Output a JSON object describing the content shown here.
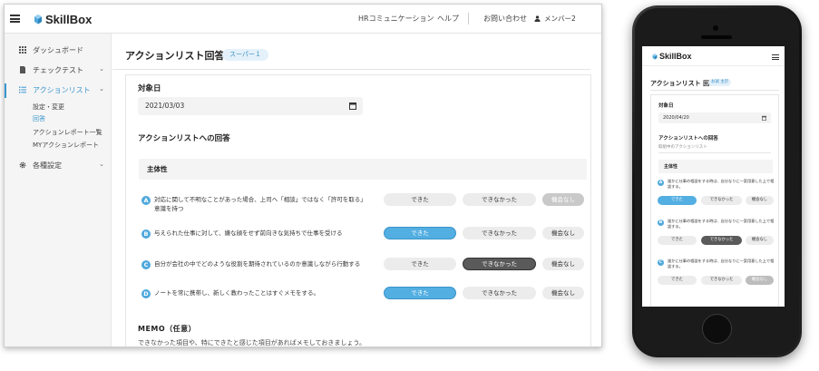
{
  "desktop": {
    "logo": "SkillBox",
    "nav": {
      "hr_communication": "HRコミュニケーション",
      "help": "ヘルプ",
      "contact": "お問い合わせ",
      "user": "メンバー2"
    },
    "sidebar": {
      "items": [
        {
          "label": "ダッシュボード",
          "icon": "grid-icon"
        },
        {
          "label": "チェックテスト",
          "icon": "document-icon"
        },
        {
          "label": "アクションリスト",
          "icon": "list-icon"
        },
        {
          "label": "各種設定",
          "icon": "gear-icon"
        }
      ],
      "sub_items": [
        "設定・変更",
        "回答",
        "アクションレポート一覧",
        "MYアクションレポート"
      ]
    },
    "page_title": "アクションリスト回答",
    "badge": "スーパー１",
    "date_label": "対象日",
    "date_value": "2021/03/03",
    "answers_heading": "アクションリストへの回答",
    "category": "主体性",
    "options": [
      "できた",
      "できなかった",
      "機会なし"
    ],
    "questions": [
      {
        "letter": "A",
        "text": "対応に関して不明なことがあった場合、上司へ「相談」ではなく「許可を取る」意識を持つ",
        "selected": 2
      },
      {
        "letter": "B",
        "text": "与えられた仕事に対して、嫌な顔をせず前向きな気持ちで仕事を受ける",
        "selected": 0
      },
      {
        "letter": "C",
        "text": "自分が会社の中でどのような役割を期待されているのか意識しながら行動する",
        "selected": 1
      },
      {
        "letter": "D",
        "text": "ノートを常に携帯し、新しく教わったことはすぐメモをする。",
        "selected": 0
      }
    ],
    "memo_title": "MEMO（任意）",
    "memo_desc": "できなかった項目や、特にできたと感じた項目があればメモしておきましょう。"
  },
  "mobile": {
    "logo": "SkillBox",
    "page_title": "アクションリスト 回答",
    "badge": "お試 主於",
    "date_label": "対象日",
    "date_value": "2020/04/20",
    "answers_heading": "アクションリストへの回答",
    "help": "取組中のアクションリスト",
    "category": "主体性",
    "options": [
      "できた",
      "できなかった",
      "機会なし"
    ],
    "questions": [
      {
        "letter": "A",
        "text": "誰かに仕事の相談をする時は、自分なりに一案用意した上で相談する。",
        "selected": 0
      },
      {
        "letter": "B",
        "text": "誰かに仕事の相談をする時は、自分なりに一案用意した上で相談する。",
        "selected": 1
      },
      {
        "letter": "C",
        "text": "誰かに仕事の相談をする時は、自分なりに一案用意した上で相談する。",
        "selected": 2
      }
    ]
  },
  "colors": {
    "accent": "#53aee2",
    "dark": "#5a5a5a",
    "disabled": "#c9c9c9"
  }
}
